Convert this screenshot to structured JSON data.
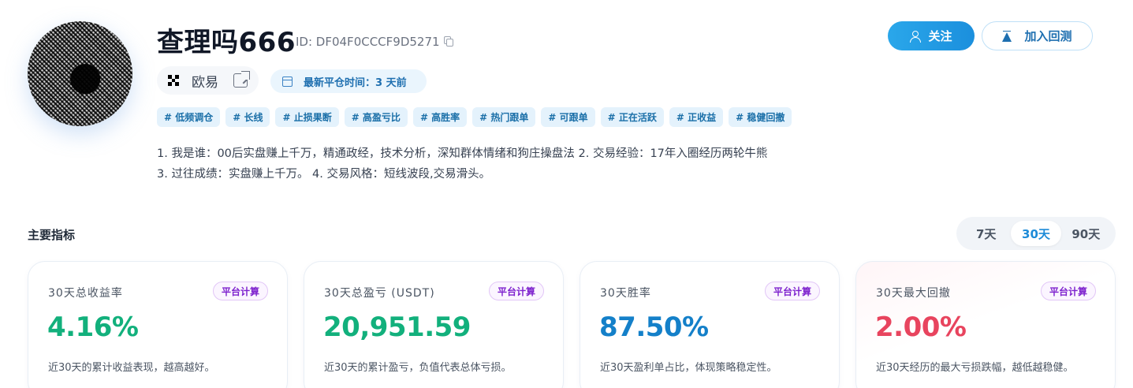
{
  "profile": {
    "name": "查理吗666",
    "id_text": "ID: DF04F0CCCF9D5271",
    "exchange": "欧易",
    "recent_close": "最新平仓时间：3 天前",
    "tags": [
      "# 低频调仓",
      "# 长线",
      "# 止损果断",
      "# 高盈亏比",
      "# 高胜率",
      "# 热门跟单",
      "# 可跟单",
      "# 正在活跃",
      "# 正收益",
      "# 稳健回撤"
    ],
    "bio_line1": "1. 我是谁：00后实盘赚上千万，精通政经，技术分析，深知群体情绪和狗庄操盘法 2. 交易经验：17年入圈经历两轮牛熊",
    "bio_line2": "3. 过往成绩：实盘赚上千万。 4. 交易风格：短线波段,交易滑头。"
  },
  "actions": {
    "follow_label": "关注",
    "backtest_label": "加入回测"
  },
  "metrics": {
    "section_title": "主要指标",
    "periods": [
      "7天",
      "30天",
      "90天"
    ],
    "active_period": "30天",
    "cards": [
      {
        "label": "30天总收益率",
        "badge": "平台计算",
        "value": "4.16%",
        "desc": "近30天的累计收益表现，越高越好。",
        "color": "#12b07c"
      },
      {
        "label": "30天总盈亏 (USDT)",
        "badge": "平台计算",
        "value": "20,951.59",
        "desc": "近30天的累计盈亏，负值代表总体亏损。",
        "color": "#12b07c"
      },
      {
        "label": "30天胜率",
        "badge": "平台计算",
        "value": "87.50%",
        "desc": "近30天盈利单占比，体现策略稳定性。",
        "color": "#1480c9"
      },
      {
        "label": "30天最大回撤",
        "badge": "平台计算",
        "value": "2.00%",
        "desc": "近30天经历的最大亏损跌幅，越低越稳健。",
        "color": "#e8445e"
      }
    ]
  }
}
